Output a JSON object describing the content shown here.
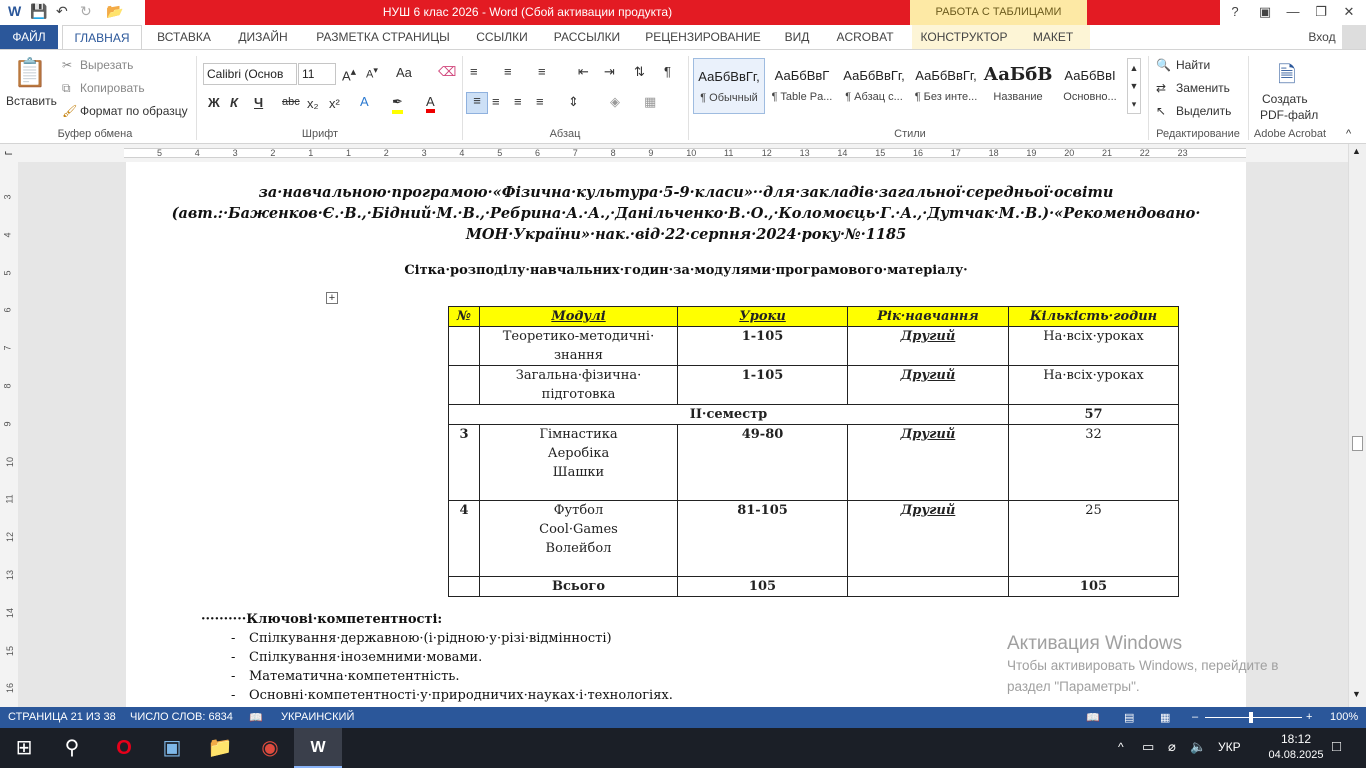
{
  "titlebar": {
    "title": "НУШ 6 клас 2026 -  Word (Сбой активации продукта)",
    "context_tab_group": "РАБОТА С ТАБЛИЦАМИ",
    "help": "?",
    "user": "Вход"
  },
  "tabs": {
    "file": "ФАЙЛ",
    "items": [
      "ГЛАВНАЯ",
      "ВСТАВКА",
      "ДИЗАЙН",
      "РАЗМЕТКА СТРАНИЦЫ",
      "ССЫЛКИ",
      "РАССЫЛКИ",
      "РЕЦЕНЗИРОВАНИЕ",
      "ВИД",
      "ACROBAT",
      "КОНСТРУКТОР",
      "МАКЕТ"
    ],
    "active": "ГЛАВНАЯ"
  },
  "ribbon": {
    "clipboard": {
      "paste": "Вставить",
      "cut": "Вырезать",
      "copy": "Копировать",
      "format_painter": "Формат по образцу",
      "label": "Буфер обмена"
    },
    "font": {
      "font_name": "Calibri (Основ",
      "font_size": "11",
      "label": "Шрифт",
      "bold": "Ж",
      "italic": "К",
      "underline": "Ч",
      "strike": "abc",
      "sub": "x₂",
      "sup": "x²",
      "case": "Aa"
    },
    "paragraph": {
      "label": "Абзац"
    },
    "styles": {
      "label": "Стили",
      "items": [
        {
          "sample": "АаБбВвГг,",
          "name": "¶ Обычный"
        },
        {
          "sample": "АаБбВвГ",
          "name": "¶ Table Pa..."
        },
        {
          "sample": "АаБбВвГг,",
          "name": "¶ Абзац с..."
        },
        {
          "sample": "АаБбВвГг,",
          "name": "¶ Без инте..."
        },
        {
          "sample": "АаБбВ",
          "name": "Название"
        },
        {
          "sample": "АаБбВвI",
          "name": "Основно..."
        }
      ]
    },
    "editing": {
      "label": "Редактирование",
      "find": "Найти",
      "replace": "Заменить",
      "select": "Выделить"
    },
    "acrobat": {
      "create_pdf_1": "Создать",
      "create_pdf_2": "PDF-файл",
      "label": "Adobe Acrobat"
    }
  },
  "ruler": {
    "marks": [
      "5",
      "4",
      "3",
      "2",
      "1",
      "1",
      "2",
      "3",
      "4",
      "5",
      "6",
      "7",
      "8",
      "9",
      "10",
      "11",
      "12",
      "13",
      "14",
      "15",
      "16",
      "17",
      "18",
      "19",
      "20",
      "21",
      "22",
      "23"
    ],
    "vmarks": [
      "3",
      "4",
      "5",
      "6",
      "7",
      "8",
      "9",
      "10",
      "11",
      "12",
      "13",
      "14",
      "15",
      "16"
    ]
  },
  "document": {
    "intro_line1": "за·навчальною·програмою·«Фізична·культура·5-9·класи»··для·закладів·загальної·середньої·освіти",
    "intro_line2": "(авт.:·Баженков·Є.·В.,·Бідний·М.·В.,·Ребрина·А.·А.,·Данільченко·В.·О.,·Коломоєць·Г.·А.,·Дутчак·М.·В.)·«Рекомендовано·",
    "intro_line3": "МОН·України»·нак.·від·22·серпня·2024·року·№·1185",
    "table_title": "Сітка·розподілу·навчальних·годин·за·модулями·програмового·матеріалу·",
    "table": {
      "headers": [
        "№",
        "Модулі",
        "Уроки",
        "Рік·навчання",
        "Кількість·годин"
      ],
      "rows": [
        {
          "num": "",
          "module": "Теоретико-методичні· знання",
          "lessons": "1-105",
          "year": "Другий",
          "hours": "На·всіх·уроках"
        },
        {
          "num": "",
          "module": "Загальна·фізична· підготовка",
          "lessons": "1-105",
          "year": "Другий",
          "hours": "На·всіх·уроках"
        }
      ],
      "semester_label": "ІІ·семестр",
      "semester_hours": "57",
      "rows2": [
        {
          "num": "3",
          "module_lines": [
            "Гімнастика",
            "Аеробіка",
            "Шашки"
          ],
          "lessons": "49-80",
          "year": "Другий",
          "hours": "32"
        },
        {
          "num": "4",
          "module_lines": [
            "Футбол",
            "Cool·Games",
            "Волейбол"
          ],
          "lessons": "81-105",
          "year": "Другий",
          "hours": "25"
        }
      ],
      "total_label": "Всього",
      "total_lessons": "105",
      "total_hours": "105"
    },
    "competencies_title": "··········Ключові·компетентності:",
    "competencies": [
      "Спілкування·державною·(і·рідною·у·різі·відмінності)",
      "Спілкування·іноземними·мовами.",
      "Математична·компетентність.",
      "Основні·компетентності·у·природничих·науках·і·технологіях."
    ],
    "watermark_title": "Активация Windows",
    "watermark_line1": "Чтобы активировать Windows, перейдите в",
    "watermark_line2": "раздел \"Параметры\"."
  },
  "statusbar": {
    "page": "СТРАНИЦА 21 ИЗ 38",
    "words": "ЧИСЛО СЛОВ: 6834",
    "language": "УКРАИНСКИЙ",
    "zoom": "100%"
  },
  "taskbar": {
    "lang": "УКР",
    "time": "18:12",
    "date": "04.08.2025"
  }
}
